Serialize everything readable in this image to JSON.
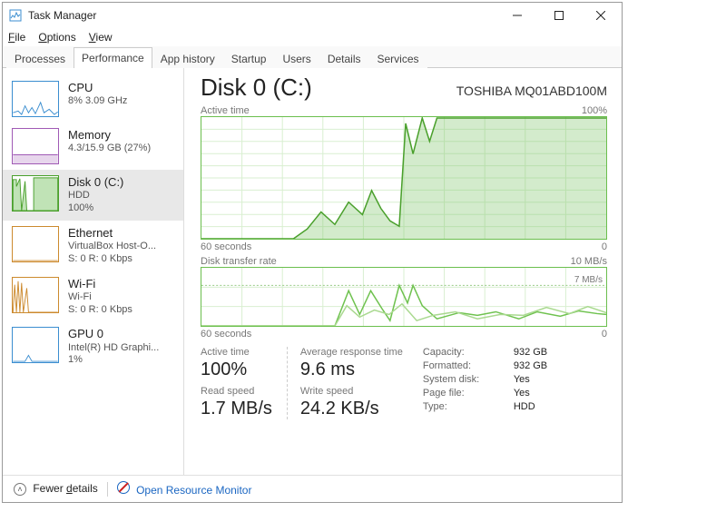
{
  "window": {
    "title": "Task Manager"
  },
  "menu": {
    "file": "File",
    "options": "Options",
    "view": "View"
  },
  "tabs": [
    {
      "id": "processes",
      "label": "Processes"
    },
    {
      "id": "performance",
      "label": "Performance"
    },
    {
      "id": "apphistory",
      "label": "App history"
    },
    {
      "id": "startup",
      "label": "Startup"
    },
    {
      "id": "users",
      "label": "Users"
    },
    {
      "id": "details",
      "label": "Details"
    },
    {
      "id": "services",
      "label": "Services"
    }
  ],
  "active_tab": "performance",
  "sidebar": [
    {
      "key": "cpu",
      "title": "CPU",
      "line1": "8% 3.09 GHz"
    },
    {
      "key": "memory",
      "title": "Memory",
      "line1": "4.3/15.9 GB (27%)"
    },
    {
      "key": "disk0",
      "title": "Disk 0 (C:)",
      "line1": "HDD",
      "line2": "100%",
      "selected": true
    },
    {
      "key": "ethernet",
      "title": "Ethernet",
      "line1": "VirtualBox Host-O...",
      "line2": "S: 0 R: 0 Kbps"
    },
    {
      "key": "wifi",
      "title": "Wi-Fi",
      "line1": "Wi-Fi",
      "line2": "S: 0 R: 0 Kbps"
    },
    {
      "key": "gpu0",
      "title": "GPU 0",
      "line1": "Intel(R) HD Graphi...",
      "line2": "1%"
    }
  ],
  "main": {
    "heading": "Disk 0 (C:)",
    "model": "TOSHIBA MQ01ABD100M",
    "chart1": {
      "leftTop": "Active time",
      "rightTop": "100%",
      "leftBottom": "60 seconds",
      "rightBottom": "0"
    },
    "chart2": {
      "leftTop": "Disk transfer rate",
      "rightTop": "10 MB/s",
      "rightIn": "7 MB/s",
      "leftBottom": "60 seconds",
      "rightBottom": "0"
    },
    "stats": {
      "active_time_label": "Active time",
      "active_time_value": "100%",
      "avg_resp_label": "Average response time",
      "avg_resp_value": "9.6 ms",
      "read_label": "Read speed",
      "read_value": "1.7 MB/s",
      "write_label": "Write speed",
      "write_value": "24.2 KB/s"
    },
    "kv": {
      "capacity_l": "Capacity:",
      "capacity_v": "932 GB",
      "formatted_l": "Formatted:",
      "formatted_v": "932 GB",
      "sysdisk_l": "System disk:",
      "sysdisk_v": "Yes",
      "pagefile_l": "Page file:",
      "pagefile_v": "Yes",
      "type_l": "Type:",
      "type_v": "HDD"
    }
  },
  "footer": {
    "fewer": "Fewer details",
    "orm": "Open Resource Monitor"
  },
  "chart_data": [
    {
      "type": "line",
      "title": "Active time",
      "ylabel": "%",
      "ylim": [
        0,
        100
      ],
      "xlabel": "seconds",
      "xlim": [
        60,
        0
      ],
      "x": [
        60,
        55,
        50,
        45,
        42,
        40,
        38,
        36,
        34,
        33,
        32,
        31,
        30,
        29,
        28,
        27,
        26,
        25,
        20,
        15,
        10,
        5,
        0
      ],
      "values": [
        0,
        0,
        0,
        0,
        8,
        22,
        12,
        30,
        20,
        40,
        25,
        15,
        10,
        95,
        70,
        100,
        80,
        100,
        100,
        100,
        100,
        100,
        100
      ]
    },
    {
      "type": "line",
      "title": "Disk transfer rate",
      "ylabel": "MB/s",
      "ylim": [
        0,
        10
      ],
      "xlabel": "seconds",
      "xlim": [
        60,
        0
      ],
      "series": [
        {
          "name": "read",
          "x": [
            60,
            40,
            38,
            36,
            34,
            32,
            31,
            30,
            29,
            28,
            27,
            25,
            20,
            15,
            10,
            5,
            0
          ],
          "values": [
            0,
            0,
            6,
            2,
            6,
            3,
            1,
            7,
            4,
            7,
            3.5,
            1.2,
            2.3,
            1.9,
            2.4,
            2.6,
            2.0
          ]
        },
        {
          "name": "write",
          "x": [
            60,
            40,
            38,
            35,
            32,
            30,
            28,
            25,
            22,
            18,
            14,
            10,
            6,
            2,
            0
          ],
          "values": [
            0,
            0,
            3.5,
            1.5,
            2.8,
            2.0,
            3.8,
            1.0,
            1.8,
            2.5,
            1.2,
            2.0,
            1.8,
            3.2,
            2.2
          ]
        }
      ],
      "annotation": "7 MB/s"
    }
  ]
}
